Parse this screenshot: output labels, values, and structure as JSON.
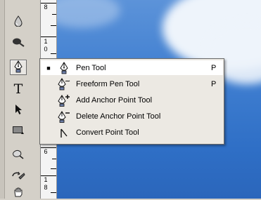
{
  "toolbox": {
    "tools": [
      {
        "name": "blur-tool",
        "icon": "water-drop-icon"
      },
      {
        "name": "dodge-tool",
        "icon": "dodge-icon"
      },
      {
        "name": "pen-tool",
        "icon": "pen-icon",
        "active": true
      },
      {
        "name": "type-tool",
        "icon": "type-icon",
        "glyph": "T"
      },
      {
        "name": "path-selection-tool",
        "icon": "arrow-icon"
      },
      {
        "name": "rectangle-tool",
        "icon": "rectangle-icon"
      },
      {
        "name": "notes-tool",
        "icon": "notes-icon"
      },
      {
        "name": "eyedropper-tool",
        "icon": "eyedropper-icon"
      },
      {
        "name": "hand-tool",
        "icon": "hand-icon"
      }
    ]
  },
  "ruler": {
    "labels": [
      "8",
      "1",
      "0",
      "6",
      "1",
      "8"
    ]
  },
  "flyout": {
    "items": [
      {
        "label": "Pen Tool",
        "shortcut": "P",
        "icon": "pen-icon",
        "selected": true,
        "bullet": "■"
      },
      {
        "label": "Freeform Pen Tool",
        "shortcut": "P",
        "icon": "freeform-pen-icon"
      },
      {
        "label": "Add Anchor Point Tool",
        "shortcut": "",
        "icon": "add-anchor-icon"
      },
      {
        "label": "Delete Anchor Point Tool",
        "shortcut": "",
        "icon": "delete-anchor-icon"
      },
      {
        "label": "Convert Point Tool",
        "shortcut": "",
        "icon": "convert-point-icon"
      }
    ]
  },
  "colors": {
    "sky": "#3f7ed0",
    "menu_bg": "#ece9e3",
    "toolbox_bg": "#d4d0c8"
  }
}
